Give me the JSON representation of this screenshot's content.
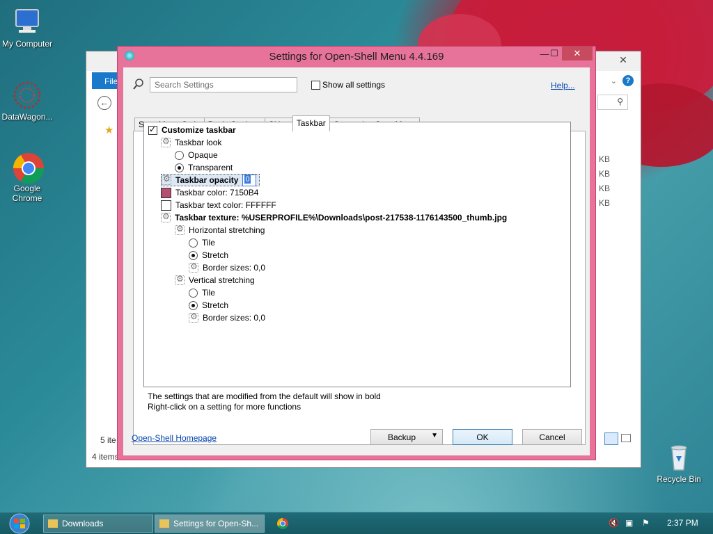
{
  "desktop": {
    "icons": [
      {
        "label": "My Computer",
        "icon": "computer-icon"
      },
      {
        "label": "DataWagon...",
        "icon": "datawagon-icon"
      },
      {
        "label": "Google Chrome",
        "icon": "chrome-icon"
      },
      {
        "label": "Recycle Bin",
        "icon": "recycle-bin-icon"
      }
    ]
  },
  "explorer": {
    "file_tab": "File",
    "status_items": "5 ite",
    "status_bottom": "4 items",
    "sizes": [
      "KB",
      "KB",
      "KB",
      "KB"
    ]
  },
  "dialog": {
    "title": "Settings for Open-Shell Menu 4.4.169",
    "search_placeholder": "Search Settings",
    "show_all_label": "Show all settings",
    "help_link": "Help...",
    "tabs": [
      "Start Menu Style",
      "Basic Settings",
      "Skin",
      "Taskbar",
      "Customize Start Menu"
    ],
    "active_tab": "Taskbar",
    "tree": {
      "customize_taskbar": "Customize taskbar",
      "taskbar_look": "Taskbar look",
      "opaque": "Opaque",
      "transparent": "Transparent",
      "taskbar_opacity": "Taskbar opacity",
      "opacity_value": "0",
      "taskbar_color": "Taskbar color: 7150B4",
      "taskbar_text_color": "Taskbar text color: FFFFFF",
      "taskbar_texture": "Taskbar texture: %USERPROFILE%\\Downloads\\post-217538-1176143500_thumb.jpg",
      "horizontal_stretching": "Horizontal stretching",
      "h_tile": "Tile",
      "h_stretch": "Stretch",
      "h_border": "Border sizes: 0,0",
      "vertical_stretching": "Vertical stretching",
      "v_tile": "Tile",
      "v_stretch": "Stretch",
      "v_border": "Border sizes: 0,0"
    },
    "note1": "The settings that are modified from the default will show in bold",
    "note2": "Right-click on a setting for more functions",
    "homepage_link": "Open-Shell Homepage",
    "backup_label": "Backup",
    "ok_label": "OK",
    "cancel_label": "Cancel"
  },
  "taskbar": {
    "buttons": [
      "Downloads",
      "Settings for Open-Sh..."
    ],
    "clock": "2:37 PM"
  },
  "colors": {
    "taskbar_color_swatch": "#B45071",
    "text_color_swatch": "#FFFFFF",
    "dialog_frame": "#E8739A"
  }
}
